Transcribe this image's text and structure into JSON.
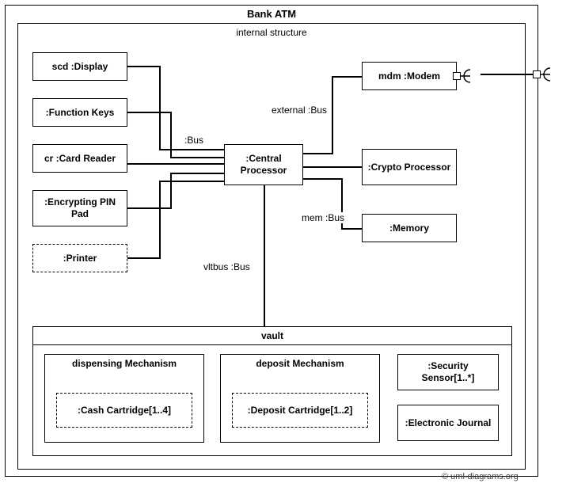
{
  "title": "Bank ATM",
  "subtitle": "internal structure",
  "nodes": {
    "display": "scd :Display",
    "function_keys": ":Function Keys",
    "card_reader": "cr :Card Reader",
    "pin_pad": ":Encrypting PIN Pad",
    "printer": ":Printer",
    "cpu": ":Central Processor",
    "modem": "mdm :Modem",
    "crypto": ":Crypto Processor",
    "memory": ":Memory"
  },
  "connectors": {
    "bus": ":Bus",
    "external": "external :Bus",
    "mem": "mem :Bus",
    "vltbus": "vltbus :Bus"
  },
  "vault": {
    "title": "vault",
    "dispensing": {
      "title": "dispensing Mechanism",
      "part": ":Cash Cartridge[1..4]"
    },
    "deposit": {
      "title": "deposit Mechanism",
      "part": ":Deposit Cartridge[1..2]"
    },
    "security": ":Security Sensor[1..*]",
    "journal": ":Electronic Journal"
  },
  "chart_data": {
    "type": "uml_composite_structure",
    "classifier": "Bank ATM",
    "parts": [
      {
        "id": "display",
        "name": "scd",
        "type": "Display"
      },
      {
        "id": "function_keys",
        "type": "Function Keys"
      },
      {
        "id": "card_reader",
        "name": "cr",
        "type": "Card Reader"
      },
      {
        "id": "pin_pad",
        "type": "Encrypting PIN Pad"
      },
      {
        "id": "printer",
        "type": "Printer",
        "optional": true
      },
      {
        "id": "cpu",
        "type": "Central Processor"
      },
      {
        "id": "modem",
        "name": "mdm",
        "type": "Modem",
        "ports": [
          "required_interface"
        ]
      },
      {
        "id": "crypto",
        "type": "Crypto Processor"
      },
      {
        "id": "memory",
        "type": "Memory"
      },
      {
        "id": "vault",
        "type": "vault",
        "parts": [
          {
            "id": "dispensing",
            "type": "dispensing Mechanism",
            "parts": [
              {
                "type": "Cash Cartridge",
                "multiplicity": "1..4",
                "optional": true
              }
            ]
          },
          {
            "id": "deposit",
            "type": "deposit Mechanism",
            "parts": [
              {
                "type": "Deposit Cartridge",
                "multiplicity": "1..2",
                "optional": true
              }
            ]
          },
          {
            "type": "Security Sensor",
            "multiplicity": "1..*"
          },
          {
            "type": "Electronic Journal"
          }
        ]
      }
    ],
    "connectors": [
      {
        "from": "display",
        "to": "cpu",
        "type": "Bus"
      },
      {
        "from": "function_keys",
        "to": "cpu",
        "type": "Bus"
      },
      {
        "from": "card_reader",
        "to": "cpu",
        "type": "Bus"
      },
      {
        "from": "pin_pad",
        "to": "cpu",
        "type": "Bus"
      },
      {
        "from": "printer",
        "to": "cpu",
        "type": "Bus"
      },
      {
        "from": "cpu",
        "to": "modem",
        "name": "external",
        "type": "Bus"
      },
      {
        "from": "cpu",
        "to": "crypto",
        "type": "Bus"
      },
      {
        "from": "cpu",
        "to": "memory",
        "name": "mem",
        "type": "Bus"
      },
      {
        "from": "cpu",
        "to": "vault",
        "name": "vltbus",
        "type": "Bus"
      }
    ],
    "external_ports": [
      {
        "on": "Bank ATM",
        "kind": "required_interface",
        "delegates_from": "modem"
      }
    ]
  },
  "copyright": "© uml-diagrams.org"
}
